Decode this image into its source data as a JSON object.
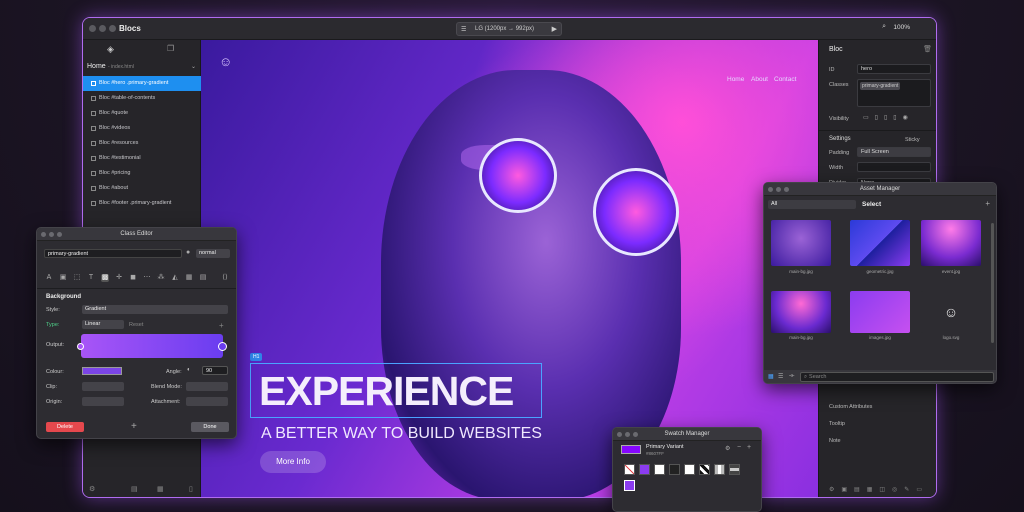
{
  "app": {
    "title": "Blocs",
    "viewport": "LG (1200px → 992px)",
    "zoom": "100%"
  },
  "sidebar": {
    "page_label": "Home",
    "page_file": "- index.html",
    "items": [
      {
        "label": "Bloc #hero .primary-gradient",
        "active": true
      },
      {
        "label": "Bloc #table-of-contents"
      },
      {
        "label": "Bloc #quote"
      },
      {
        "label": "Bloc #videos"
      },
      {
        "label": "Bloc #resources"
      },
      {
        "label": "Bloc #testimonial"
      },
      {
        "label": "Bloc #pricing"
      },
      {
        "label": "Bloc #about"
      },
      {
        "label": "Bloc #footer .primary-gradient"
      }
    ]
  },
  "canvas": {
    "nav": [
      "Home",
      "About",
      "Contact"
    ],
    "badge": "H1",
    "headline": "EXPERIENCE",
    "subheadline": "A BETTER WAY TO BUILD WEBSITES",
    "button": "More Info"
  },
  "right_panel": {
    "title": "Bloc",
    "id_label": "ID",
    "id_value": "hero",
    "classes_label": "Classes",
    "class_chip": "primary-gradient",
    "visibility_label": "Visibility",
    "settings_label": "Settings",
    "sticky_label": "Sticky",
    "padding_label": "Padding",
    "padding_value": "Full Screen",
    "width_label": "Width",
    "divider_label": "Divider",
    "divider_value": "None",
    "custom_attr": "Custom Attributes",
    "tooltip": "Tooltip",
    "note": "Note"
  },
  "class_editor": {
    "title": "Class Editor",
    "class_name": "primary-gradient",
    "state": "normal",
    "section": "Background",
    "style_label": "Style:",
    "style_value": "Gradient",
    "type_label": "Type:",
    "type_value": "Linear",
    "reset": "Reset",
    "output_label": "Output:",
    "colour_label": "Colour:",
    "angle_label": "Angle:",
    "angle_value": "90",
    "clip_label": "Clip:",
    "blend_label": "Blend Mode:",
    "origin_label": "Origin:",
    "attach_label": "Attachment:",
    "delete": "Delete",
    "done": "Done",
    "colors": {
      "grad_start": "#a855f7",
      "grad_end": "#6a3df0",
      "delete": "#e5484d"
    }
  },
  "asset_manager": {
    "title": "Asset Manager",
    "filter": "All",
    "select": "Select",
    "search_placeholder": "Search",
    "assets": [
      {
        "name": "main-bg.jpg"
      },
      {
        "name": "geometric.jpg"
      },
      {
        "name": "event.jpg"
      },
      {
        "name": "main-bg.jpg"
      },
      {
        "name": "images.jpg"
      },
      {
        "name": "logo.svg"
      }
    ]
  },
  "swatch_manager": {
    "title": "Swatch Manager",
    "name": "Primary Variant",
    "hex": "#8607FF",
    "colors": [
      "#ffffff",
      "#8b3cf0",
      "#ffffff",
      "#222222",
      "#ffffff",
      "#111111",
      "#bbbbbb",
      "#444444",
      "#8b3cf0"
    ]
  }
}
